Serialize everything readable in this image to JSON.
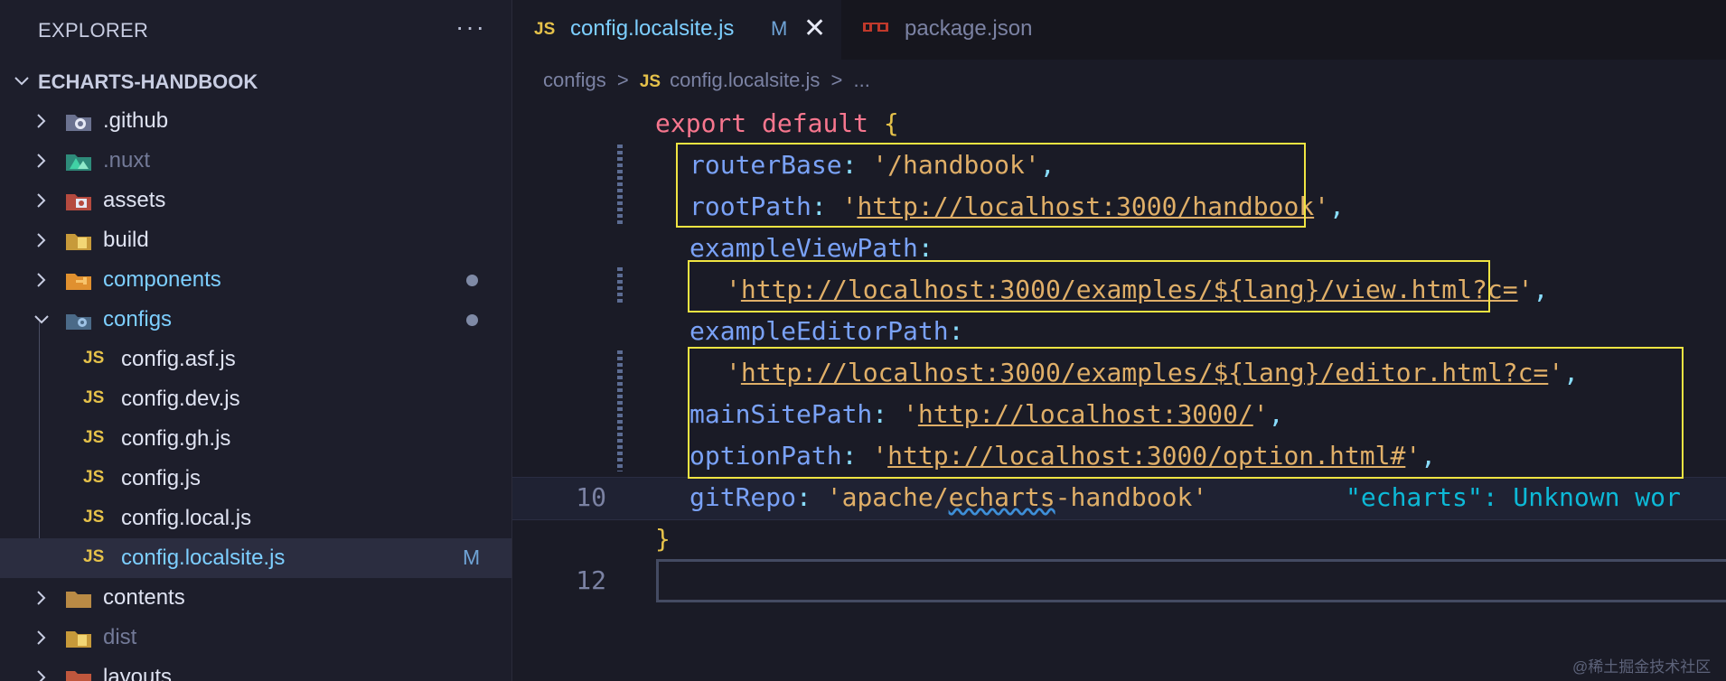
{
  "sidebar": {
    "title": "EXPLORER",
    "more": "···",
    "root": "ECHARTS-HANDBOOK",
    "items": [
      {
        "label": ".github",
        "icon": "github-folder-icon",
        "color": "#dfe3f2"
      },
      {
        "label": ".nuxt",
        "icon": "nuxt-folder-icon",
        "color": "#737a98"
      },
      {
        "label": "assets",
        "icon": "assets-folder-icon",
        "color": "#dfe3f2"
      },
      {
        "label": "build",
        "icon": "build-folder-icon",
        "color": "#dfe3f2"
      },
      {
        "label": "components",
        "icon": "components-folder-icon",
        "color": "#7dcfff"
      },
      {
        "label": "configs",
        "icon": "configs-folder-icon",
        "color": "#7dcfff"
      },
      {
        "label": "config.asf.js",
        "icon": "js-file-icon"
      },
      {
        "label": "config.dev.js",
        "icon": "js-file-icon"
      },
      {
        "label": "config.gh.js",
        "icon": "js-file-icon"
      },
      {
        "label": "config.js",
        "icon": "js-file-icon"
      },
      {
        "label": "config.local.js",
        "icon": "js-file-icon"
      },
      {
        "label": "config.localsite.js",
        "icon": "js-file-icon",
        "badge": "M"
      },
      {
        "label": "contents",
        "icon": "contents-folder-icon",
        "color": "#dfe3f2"
      },
      {
        "label": "dist",
        "icon": "dist-folder-icon",
        "color": "#737a98"
      },
      {
        "label": "layouts",
        "icon": "layouts-folder-icon",
        "color": "#dfe3f2"
      }
    ]
  },
  "tabs": [
    {
      "icon_text": "JS",
      "label": "config.localsite.js",
      "badge": "M",
      "close": "✕"
    },
    {
      "label": "package.json",
      "icon": "npm-icon"
    }
  ],
  "breadcrumb": {
    "folder": "configs",
    "sep": ">",
    "js": "JS",
    "file": "config.localsite.js",
    "rest": "..."
  },
  "code": {
    "l_export": "export",
    "l_default": "default",
    "l_open": "{",
    "routerBase_key": "routerBase",
    "routerBase_val": "'/handbook'",
    "rootPath_key": "rootPath",
    "rootPath_q1": "'",
    "rootPath_url": "http://localhost:3000/handbook",
    "rootPath_q2": "'",
    "exampleViewPath_key": "exampleViewPath",
    "exampleView_q1": "'",
    "exampleView_url": "http://localhost:3000/examples/${lang}/view.html?c=",
    "exampleView_q2": "'",
    "exampleEditorPath_key": "exampleEditorPath",
    "exampleEditor_q1": "'",
    "exampleEditor_url": "http://localhost:3000/examples/${lang}/editor.html?c=",
    "exampleEditor_q2": "'",
    "mainSitePath_key": "mainSitePath",
    "mainSite_q1": "'",
    "mainSite_url": "http://localhost:3000/",
    "mainSite_q2": "'",
    "optionPath_key": "optionPath",
    "option_q1": "'",
    "option_url": "http://localhost:3000/option.html#",
    "option_q2": "'",
    "gitRepo_key": "gitRepo",
    "gitRepo_v1": "'apache/",
    "gitRepo_v2": "echarts",
    "gitRepo_v3": "-handbook'",
    "diagnostic": "\"echarts\": Unknown wor",
    "close": "}",
    "line_10": "10",
    "line_12": "12"
  },
  "watermark": "@稀土掘金技术社区",
  "colors": {
    "accent": "#7dcfff",
    "highlight_box": "#f0e442",
    "string": "#e0af68",
    "key": "#7aa2f7"
  }
}
